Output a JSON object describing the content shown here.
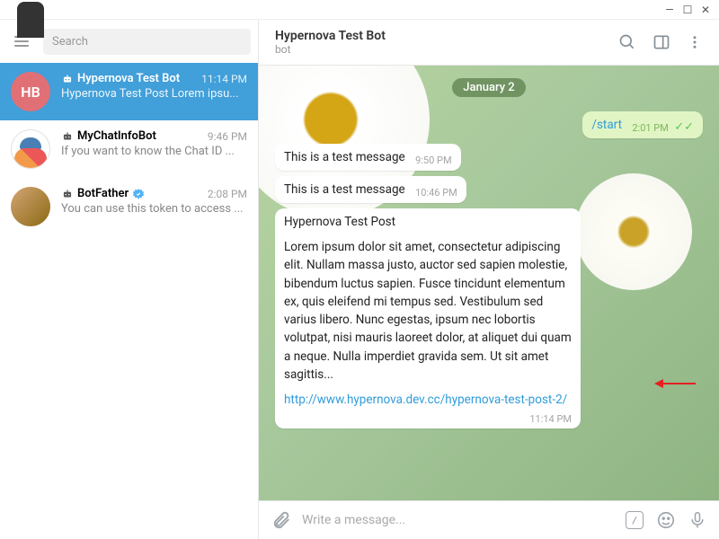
{
  "window": {
    "minimize": "—",
    "maximize": "☐",
    "close": "✕"
  },
  "search": {
    "placeholder": "Search"
  },
  "chats": [
    {
      "name": "Hypernova Test Bot",
      "time": "11:14 PM",
      "preview": "Hypernova Test Post  Lorem ipsu...",
      "avatar_initials": "HB"
    },
    {
      "name": "MyChatInfoBot",
      "time": "9:46 PM",
      "preview": "If you want to know the Chat ID ..."
    },
    {
      "name": "BotFather",
      "time": "2:08 PM",
      "preview": "You can use this token to access ..."
    }
  ],
  "header": {
    "title": "Hypernova Test Bot",
    "subtitle": "bot"
  },
  "date_badge": "January 2",
  "messages": {
    "start": {
      "text": "/start",
      "time": "2:01 PM"
    },
    "m1": {
      "text": "This is a test message",
      "time": "9:50 PM"
    },
    "m2": {
      "text": "This is a test message",
      "time": "10:46 PM"
    },
    "post": {
      "title": "Hypernova Test Post",
      "body": "Lorem ipsum dolor sit amet, consectetur adipiscing elit. Nullam massa justo, auctor sed sapien molestie, bibendum luctus sapien. Fusce tincidunt elementum ex, quis eleifend mi tempus sed. Vestibulum sed varius libero. Nunc egestas, ipsum nec lobortis volutpat, nisi mauris laoreet dolor, at aliquet dui quam a neque. Nulla imperdiet gravida sem. Ut sit amet sagittis...",
      "link": "http://www.hypernova.dev.cc/hypernova-test-post-2/",
      "time": "11:14 PM"
    }
  },
  "composer": {
    "placeholder": "Write a message..."
  }
}
